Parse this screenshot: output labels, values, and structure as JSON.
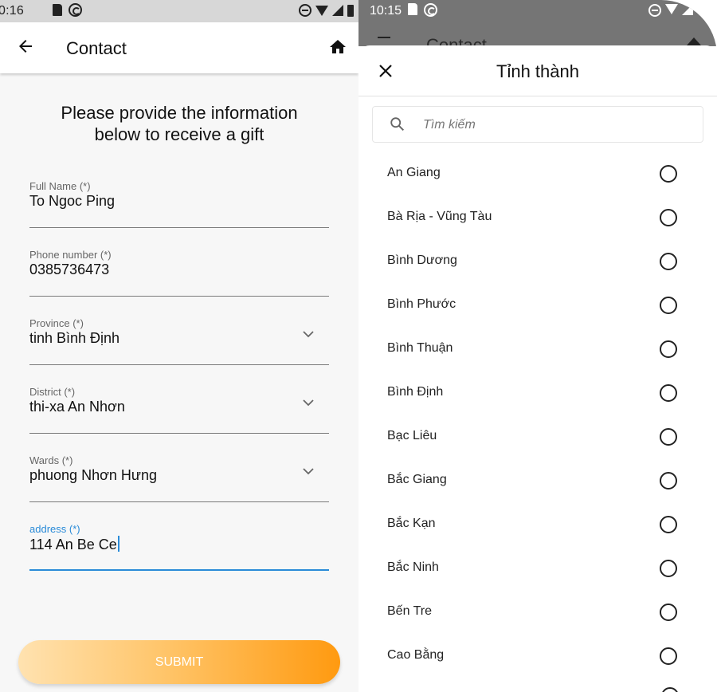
{
  "left": {
    "status_time": "0:16",
    "appbar_title": "Contact",
    "heading_line1": "Please provide the information",
    "heading_line2": "below to receive a gift",
    "fields": [
      {
        "label": "Full Name (*)",
        "value": "To Ngoc Ping"
      },
      {
        "label": "Phone number (*)",
        "value": "0385736473"
      },
      {
        "label": "Province (*)",
        "value": "tinh Bình Định"
      },
      {
        "label": "District (*)",
        "value": "thi-xa An Nhơn"
      },
      {
        "label": "Wards (*)",
        "value": "phuong Nhơn Hưng"
      },
      {
        "label": "address (*)",
        "value": "114 An Be Ce"
      }
    ],
    "submit_label": "SUBMIT",
    "accent_color": "#2a8bd8",
    "submit_gradient": [
      "#ffe2b0",
      "#ff9a10"
    ]
  },
  "right": {
    "status_time": "10:15",
    "behind_title": "Contact",
    "sheet_title": "Tỉnh thành",
    "search_placeholder": "Tìm kiếm",
    "provinces": [
      "An Giang",
      "Bà Rịa - Vũng Tàu",
      "Bình Dương",
      "Bình Phước",
      "Bình Thuận",
      "Bình Định",
      "Bạc Liêu",
      "Bắc Giang",
      "Bắc Kạn",
      "Bắc Ninh",
      "Bến Tre",
      "Cao Bằng"
    ]
  },
  "icons": [
    "back-arrow-icon",
    "home-icon",
    "chevron-down-icon",
    "close-icon",
    "search-icon",
    "radio-icon",
    "sd-card-icon",
    "sync-icon",
    "dnd-icon",
    "wifi-icon",
    "signal-icon",
    "battery-icon"
  ]
}
